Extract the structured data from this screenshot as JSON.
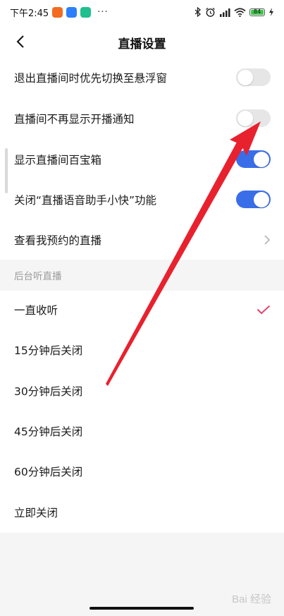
{
  "status_bar": {
    "time": "下午2:45",
    "dots": "···",
    "battery": "84"
  },
  "header": {
    "title": "直播设置"
  },
  "settings": [
    {
      "label": "退出直播间时优先切换至悬浮窗",
      "control": "toggle",
      "state": "off"
    },
    {
      "label": "直播间不再显示开播通知",
      "control": "toggle",
      "state": "off"
    },
    {
      "label": "显示直播间百宝箱",
      "control": "toggle",
      "state": "on"
    },
    {
      "label": "关闭“直播语音助手小快”功能",
      "control": "toggle",
      "state": "on"
    },
    {
      "label": "查看我预约的直播",
      "control": "chevron"
    }
  ],
  "background_listening": {
    "section_title": "后台听直播",
    "options": [
      {
        "label": "一直收听",
        "selected": true
      },
      {
        "label": "15分钟后关闭",
        "selected": false
      },
      {
        "label": "30分钟后关闭",
        "selected": false
      },
      {
        "label": "45分钟后关闭",
        "selected": false
      },
      {
        "label": "60分钟后关闭",
        "selected": false
      },
      {
        "label": "立即关闭",
        "selected": false
      }
    ]
  },
  "watermark": "Bai 经验",
  "colors": {
    "toggle_on": "#3a6ee8",
    "toggle_off": "#e6e6e6",
    "checkmark": "#e8436a",
    "arrow": "#e8212e",
    "section_bg": "#f5f5f5"
  }
}
